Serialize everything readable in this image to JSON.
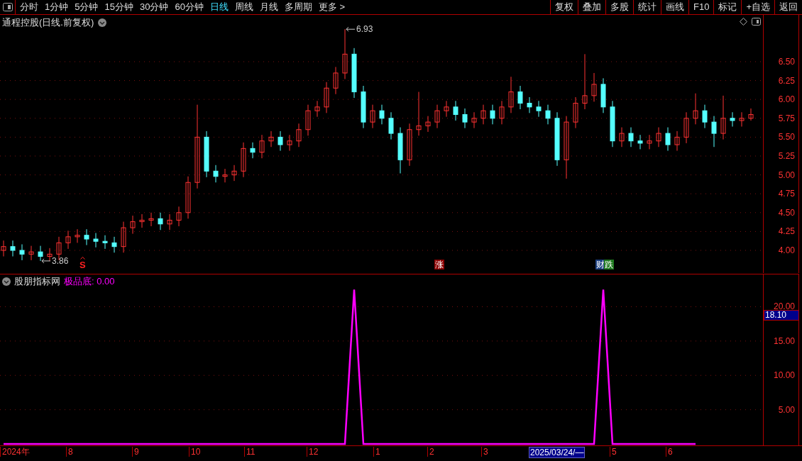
{
  "period_tabs": [
    {
      "label": "分时",
      "selected": false
    },
    {
      "label": "1分钟",
      "selected": false
    },
    {
      "label": "5分钟",
      "selected": false
    },
    {
      "label": "15分钟",
      "selected": false
    },
    {
      "label": "30分钟",
      "selected": false
    },
    {
      "label": "60分钟",
      "selected": false
    },
    {
      "label": "日线",
      "selected": true
    },
    {
      "label": "周线",
      "selected": false
    },
    {
      "label": "月线",
      "selected": false
    },
    {
      "label": "多周期",
      "selected": false
    },
    {
      "label": "更多 >",
      "selected": false
    }
  ],
  "toolbar_buttons": [
    "复权",
    "叠加",
    "多股",
    "统计",
    "画线",
    "F10",
    "标记",
    "+自选",
    "返回"
  ],
  "price_panel": {
    "title": "通程控股(日线.前复权)",
    "markers": [
      {
        "text": "S",
        "kind": "signal"
      },
      {
        "text": "涨",
        "kind": "tag",
        "color": "#8b0000"
      },
      {
        "text": "财",
        "kind": "tag",
        "color": "#1c3f80"
      },
      {
        "text": "跌",
        "kind": "tag",
        "color": "#1f7a1f"
      }
    ],
    "chart_data": {
      "type": "candlestick",
      "ohlc": [
        [
          4.0,
          4.13,
          3.92,
          4.05
        ],
        [
          4.05,
          4.13,
          3.92,
          4.0
        ],
        [
          4.0,
          4.08,
          3.87,
          3.95
        ],
        [
          3.95,
          4.06,
          3.87,
          3.98
        ],
        [
          3.98,
          4.06,
          3.86,
          3.92
        ],
        [
          3.92,
          4.03,
          3.86,
          3.95
        ],
        [
          3.95,
          4.18,
          3.87,
          4.1
        ],
        [
          4.1,
          4.26,
          4.02,
          4.18
        ],
        [
          4.18,
          4.28,
          4.1,
          4.2
        ],
        [
          4.2,
          4.28,
          4.07,
          4.15
        ],
        [
          4.15,
          4.23,
          4.04,
          4.12
        ],
        [
          4.12,
          4.2,
          4.02,
          4.1
        ],
        [
          4.1,
          4.18,
          3.97,
          4.05
        ],
        [
          4.05,
          4.38,
          3.97,
          4.3
        ],
        [
          4.3,
          4.46,
          4.22,
          4.38
        ],
        [
          4.38,
          4.48,
          4.3,
          4.4
        ],
        [
          4.4,
          4.5,
          4.32,
          4.42
        ],
        [
          4.42,
          4.5,
          4.27,
          4.35
        ],
        [
          4.35,
          4.48,
          4.27,
          4.4
        ],
        [
          4.4,
          4.58,
          4.32,
          4.5
        ],
        [
          4.5,
          4.98,
          4.42,
          4.9
        ],
        [
          4.9,
          5.93,
          4.82,
          5.5
        ],
        [
          5.5,
          5.58,
          4.97,
          5.05
        ],
        [
          5.05,
          5.13,
          4.9,
          4.98
        ],
        [
          4.98,
          5.08,
          4.9,
          5.0
        ],
        [
          5.0,
          5.13,
          4.92,
          5.05
        ],
        [
          5.05,
          5.43,
          4.97,
          5.35
        ],
        [
          5.35,
          5.43,
          5.22,
          5.3
        ],
        [
          5.3,
          5.53,
          5.22,
          5.45
        ],
        [
          5.45,
          5.58,
          5.37,
          5.5
        ],
        [
          5.5,
          5.58,
          5.32,
          5.4
        ],
        [
          5.4,
          5.53,
          5.32,
          5.45
        ],
        [
          5.45,
          5.68,
          5.37,
          5.6
        ],
        [
          5.6,
          5.93,
          5.52,
          5.85
        ],
        [
          5.85,
          5.98,
          5.77,
          5.9
        ],
        [
          5.9,
          6.23,
          5.82,
          6.15
        ],
        [
          6.15,
          6.43,
          6.07,
          6.35
        ],
        [
          6.35,
          6.93,
          6.27,
          6.6
        ],
        [
          6.6,
          6.68,
          6.02,
          6.1
        ],
        [
          6.1,
          6.18,
          5.62,
          5.7
        ],
        [
          5.7,
          5.93,
          5.62,
          5.85
        ],
        [
          5.85,
          5.93,
          5.67,
          5.75
        ],
        [
          5.75,
          5.83,
          5.47,
          5.55
        ],
        [
          5.55,
          5.63,
          5.02,
          5.2
        ],
        [
          5.2,
          5.68,
          5.12,
          5.6
        ],
        [
          5.6,
          6.1,
          5.52,
          5.65
        ],
        [
          5.65,
          5.78,
          5.57,
          5.7
        ],
        [
          5.7,
          5.93,
          5.62,
          5.85
        ],
        [
          5.85,
          5.98,
          5.77,
          5.9
        ],
        [
          5.9,
          5.98,
          5.72,
          5.8
        ],
        [
          5.8,
          5.88,
          5.62,
          5.7
        ],
        [
          5.7,
          5.83,
          5.62,
          5.75
        ],
        [
          5.75,
          5.93,
          5.67,
          5.85
        ],
        [
          5.85,
          5.93,
          5.67,
          5.75
        ],
        [
          5.75,
          5.98,
          5.67,
          5.9
        ],
        [
          5.9,
          6.3,
          5.82,
          6.1
        ],
        [
          6.1,
          6.18,
          5.87,
          5.95
        ],
        [
          5.95,
          6.03,
          5.82,
          5.9
        ],
        [
          5.9,
          5.98,
          5.77,
          5.85
        ],
        [
          5.85,
          5.93,
          5.67,
          5.75
        ],
        [
          5.75,
          5.83,
          5.12,
          5.2
        ],
        [
          5.2,
          5.78,
          4.95,
          5.7
        ],
        [
          5.7,
          6.03,
          5.62,
          5.95
        ],
        [
          5.95,
          6.6,
          5.87,
          6.05
        ],
        [
          6.05,
          6.35,
          5.97,
          6.2
        ],
        [
          6.2,
          6.28,
          5.82,
          5.9
        ],
        [
          5.9,
          5.98,
          5.37,
          5.45
        ],
        [
          5.45,
          5.63,
          5.37,
          5.55
        ],
        [
          5.55,
          5.63,
          5.37,
          5.45
        ],
        [
          5.45,
          5.53,
          5.34,
          5.42
        ],
        [
          5.42,
          5.53,
          5.34,
          5.45
        ],
        [
          5.45,
          5.63,
          5.37,
          5.55
        ],
        [
          5.55,
          5.63,
          5.32,
          5.4
        ],
        [
          5.4,
          5.58,
          5.32,
          5.5
        ],
        [
          5.5,
          5.83,
          5.42,
          5.75
        ],
        [
          5.75,
          6.08,
          5.67,
          5.85
        ],
        [
          5.85,
          5.93,
          5.62,
          5.7
        ],
        [
          5.7,
          5.78,
          5.37,
          5.55
        ],
        [
          5.55,
          6.05,
          5.47,
          5.75
        ],
        [
          5.75,
          5.83,
          5.64,
          5.72
        ],
        [
          5.72,
          5.83,
          5.64,
          5.75
        ],
        [
          5.75,
          5.88,
          5.72,
          5.8
        ]
      ],
      "ylim": [
        3.69,
        7.12
      ],
      "grid": true,
      "yticks": [
        {
          "value": 6.5,
          "label": "6.50"
        },
        {
          "value": 6.25,
          "label": "6.25"
        },
        {
          "value": 6.0,
          "label": "6.00"
        },
        {
          "value": 5.75,
          "label": "5.75"
        },
        {
          "value": 5.5,
          "label": "5.50"
        },
        {
          "value": 5.25,
          "label": "5.25"
        },
        {
          "value": 5.0,
          "label": "5.00"
        },
        {
          "value": 4.75,
          "label": "4.75"
        },
        {
          "value": 4.5,
          "label": "4.50"
        },
        {
          "value": 4.25,
          "label": "4.25"
        },
        {
          "value": 4.0,
          "label": "4.00"
        }
      ],
      "annotations": [
        "6.93",
        "3.86"
      ]
    }
  },
  "indicator_panel": {
    "title": "股朋指标网",
    "reading": "0.00",
    "current_value": "18.10",
    "chart_data": {
      "type": "line",
      "series": [
        {
          "name": "极品底:",
          "color": "#ff00ff",
          "values": [
            0,
            0,
            0,
            0,
            0,
            0,
            0,
            0,
            0,
            0,
            0,
            0,
            0,
            0,
            0,
            0,
            0,
            0,
            0,
            0,
            0,
            0,
            0,
            0,
            0,
            0,
            0,
            0,
            0,
            0,
            0,
            0,
            0,
            0,
            0,
            0,
            0,
            0,
            22.5,
            0,
            0,
            0,
            0,
            0,
            0,
            0,
            0,
            0,
            0,
            0,
            0,
            0,
            0,
            0,
            0,
            0,
            0,
            0,
            0,
            0,
            0,
            0,
            0,
            0,
            0,
            22.5,
            0,
            0,
            0,
            0,
            0,
            0,
            0,
            0,
            0,
            0
          ]
        }
      ],
      "ylim": [
        -0.2,
        24.8
      ],
      "grid": true,
      "yticks": [
        {
          "value": 20,
          "label": "20.00"
        },
        {
          "value": 15,
          "label": "15.00"
        },
        {
          "value": 10,
          "label": "10.00"
        },
        {
          "value": 5,
          "label": "5.00"
        }
      ]
    }
  },
  "date_axis": [
    "2024年",
    "8",
    "9",
    "10",
    "11",
    "12",
    "1",
    "2",
    "3",
    "5",
    "6"
  ],
  "cursor_date": "2025/03/24/—"
}
